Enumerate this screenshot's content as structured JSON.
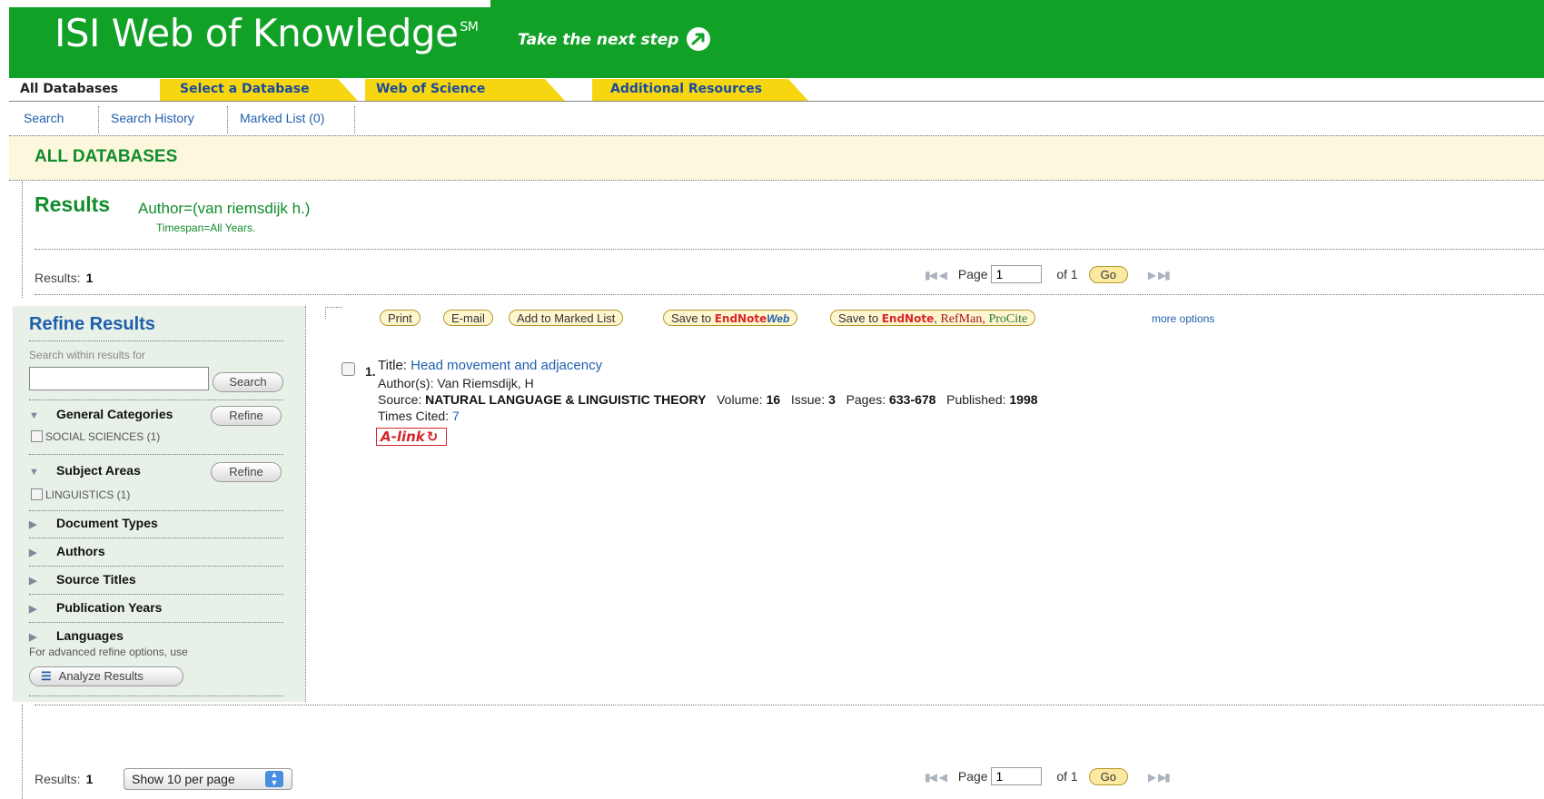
{
  "header": {
    "brand": "ISI Web of Knowledge",
    "brand_mark": "SM",
    "tagline": "Take the next step"
  },
  "tabs": [
    {
      "label": "All Databases"
    },
    {
      "label": "Select a Database"
    },
    {
      "label": "Web of Science"
    },
    {
      "label": "Additional Resources"
    }
  ],
  "subnav": {
    "search": "Search",
    "history": "Search History",
    "marked": "Marked List (0)"
  },
  "db_heading": "ALL DATABASES",
  "results_header": {
    "word": "Results",
    "query": "Author=(van riemsdijk h.)",
    "timespan": "Timespan=All Years."
  },
  "results_count": {
    "label": "Results:",
    "count": "1"
  },
  "pager": {
    "page_label": "Page",
    "page_value": "1",
    "of_label": "of 1",
    "go": "Go"
  },
  "toolbar": {
    "print": "Print",
    "email": "E-mail",
    "add_marked": "Add to Marked List",
    "save_to": "Save to",
    "endnote": "EndNote",
    "web": "Web",
    "refman": "RefMan,",
    "procite": "ProCite",
    "more_options": "more options"
  },
  "refine": {
    "title": "Refine Results",
    "search_within": "Search within results for",
    "search_button": "Search",
    "general_categories": "General Categories",
    "refine_button": "Refine",
    "social_sciences": "SOCIAL SCIENCES (1)",
    "subject_areas": "Subject Areas",
    "linguistics": "LINGUISTICS (1)",
    "document_types": "Document Types",
    "authors": "Authors",
    "source_titles": "Source Titles",
    "publication_years": "Publication Years",
    "languages": "Languages",
    "advanced_note": "For advanced refine options, use",
    "analyze_button": "Analyze Results"
  },
  "record": {
    "number": "1.",
    "title_label": "Title:",
    "title": "Head movement and adjacency",
    "authors_label": "Author(s):",
    "authors": "Van Riemsdijk, H",
    "source_label": "Source:",
    "source": "NATURAL LANGUAGE & LINGUISTIC THEORY",
    "volume_label": "Volume:",
    "volume": "16",
    "issue_label": "Issue:",
    "issue": "3",
    "pages_label": "Pages:",
    "pages": "633-678",
    "published_label": "Published:",
    "published": "1998",
    "times_cited_label": "Times Cited:",
    "times_cited": "7",
    "alink": "A-link"
  },
  "bottom": {
    "per_page": "Show 10 per page"
  },
  "colors": {
    "header_green": "#10a126",
    "tab_yellow": "#f6d611",
    "link_blue": "#1f5fad",
    "title_green": "#0f8d2a",
    "panel_bg": "#e7f1e7"
  }
}
